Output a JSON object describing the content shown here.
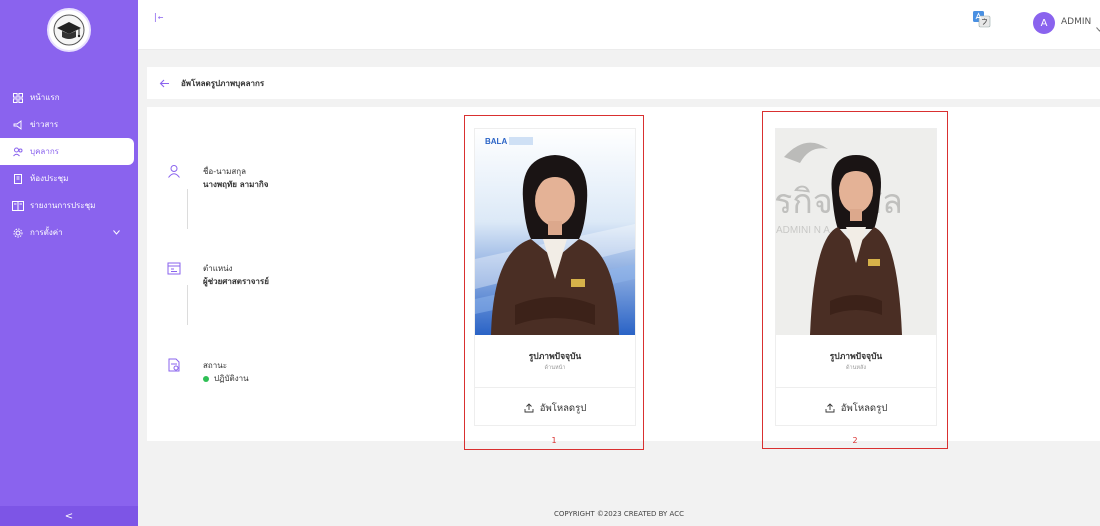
{
  "sidebar": {
    "items": [
      {
        "label": "หน้าแรก",
        "icon": "grid-icon"
      },
      {
        "label": "ข่าวสาร",
        "icon": "megaphone-icon"
      },
      {
        "label": "บุคลากร",
        "icon": "users-icon",
        "active": true
      },
      {
        "label": "ห้องประชุม",
        "icon": "door-icon"
      },
      {
        "label": "รายงานการประชุม",
        "icon": "report-icon"
      },
      {
        "label": "การตั้งค่า",
        "icon": "gear-icon",
        "has_children": true
      }
    ],
    "collapse_glyph": "<"
  },
  "topbar": {
    "toggle_glyph": "|←",
    "user": {
      "initial": "A",
      "name": "ADMIN"
    }
  },
  "header": {
    "title": "อัพโหลดรูปภาพบุคลากร"
  },
  "profile": {
    "name_label": "ชื่อ-นามสกุล",
    "name_value": "นางพฤทัย ลามากิจ",
    "position_label": "ตำแหน่ง",
    "position_value": "ผู้ช่วยศาสตราจารย์",
    "status_label": "สถานะ",
    "status_value": "ปฏิบัติงาน"
  },
  "photos": [
    {
      "caption": "รูปภาพปัจจุบัน",
      "side": "ด้านหน้า",
      "upload_label": "อัพโหลดรูป",
      "number": "1",
      "brand": "BALA"
    },
    {
      "caption": "รูปภาพปัจจุบัน",
      "side": "ด้านหลัง",
      "upload_label": "อัพโหลดรูป",
      "number": "2",
      "bg_text": "รกิจ ะศิล",
      "bg_text2": "ADMINI N A"
    }
  ],
  "footer": {
    "text": "COPYRIGHT ©2023 CREATED BY ACC"
  },
  "colors": {
    "accent": "#8a63ee",
    "frame": "#d93030",
    "status": "#2fbf55"
  }
}
